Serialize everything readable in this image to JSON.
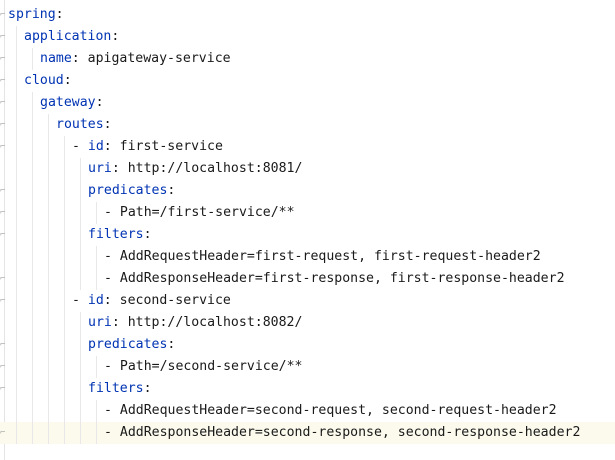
{
  "editor": {
    "lines": [
      {
        "indent": 0,
        "dash": "",
        "key": "spring",
        "sep": ":",
        "value": "",
        "fold": true
      },
      {
        "indent": 1,
        "dash": "",
        "key": "application",
        "sep": ":",
        "value": "",
        "fold": true
      },
      {
        "indent": 2,
        "dash": "",
        "key": "name",
        "sep": ":",
        "value": " apigateway-service",
        "fold": true
      },
      {
        "indent": 1,
        "dash": "",
        "key": "cloud",
        "sep": ":",
        "value": "",
        "fold": true
      },
      {
        "indent": 2,
        "dash": "",
        "key": "gateway",
        "sep": ":",
        "value": "",
        "fold": true
      },
      {
        "indent": 3,
        "dash": "",
        "key": "routes",
        "sep": ":",
        "value": "",
        "fold": true
      },
      {
        "indent": 4,
        "dash": "- ",
        "key": "id",
        "sep": ":",
        "value": " first-service",
        "fold": true
      },
      {
        "indent": 5,
        "dash": "",
        "key": "uri",
        "sep": ":",
        "value": " http://localhost:8081/",
        "fold": false
      },
      {
        "indent": 5,
        "dash": "",
        "key": "predicates",
        "sep": ":",
        "value": "",
        "fold": true
      },
      {
        "indent": 6,
        "dash": "- ",
        "key": "",
        "sep": "",
        "value": "Path=/first-service/**",
        "fold": true
      },
      {
        "indent": 5,
        "dash": "",
        "key": "filters",
        "sep": ":",
        "value": "",
        "fold": true
      },
      {
        "indent": 6,
        "dash": "- ",
        "key": "",
        "sep": "",
        "value": "AddRequestHeader=first-request, first-request-header2",
        "fold": false
      },
      {
        "indent": 6,
        "dash": "- ",
        "key": "",
        "sep": "",
        "value": "AddResponseHeader=first-response, first-response-header2",
        "fold": true
      },
      {
        "indent": 4,
        "dash": "- ",
        "key": "id",
        "sep": ":",
        "value": " second-service",
        "fold": true
      },
      {
        "indent": 5,
        "dash": "",
        "key": "uri",
        "sep": ":",
        "value": " http://localhost:8082/",
        "fold": false
      },
      {
        "indent": 5,
        "dash": "",
        "key": "predicates",
        "sep": ":",
        "value": "",
        "fold": true
      },
      {
        "indent": 6,
        "dash": "- ",
        "key": "",
        "sep": "",
        "value": "Path=/second-service/**",
        "fold": true
      },
      {
        "indent": 5,
        "dash": "",
        "key": "filters",
        "sep": ":",
        "value": "",
        "fold": true
      },
      {
        "indent": 6,
        "dash": "- ",
        "key": "",
        "sep": "",
        "value": "AddRequestHeader=second-request, second-request-header2",
        "fold": false
      },
      {
        "indent": 6,
        "dash": "- ",
        "key": "",
        "sep": "",
        "value": "AddResponseHeader=second-response, second-response-header2",
        "fold": true,
        "current": true
      }
    ]
  },
  "colors": {
    "key": "#0033b3",
    "text": "#1a1a1a",
    "current_line": "#fcfaed",
    "indent_guide": "#e8e8e8"
  },
  "icons": {
    "fold": "fold-marker-icon"
  }
}
